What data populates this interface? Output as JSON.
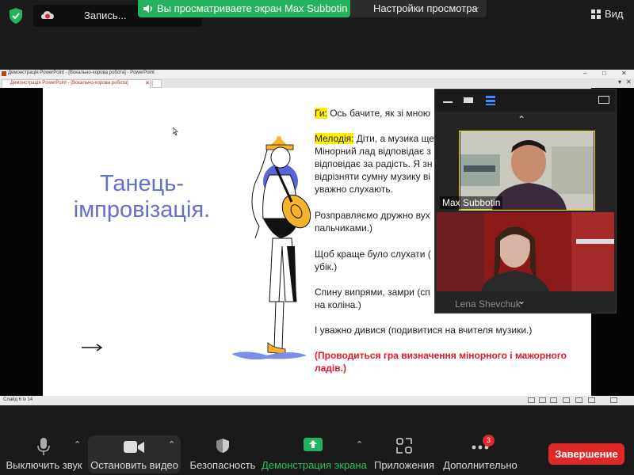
{
  "top": {
    "recording_label": "Запись...",
    "share_banner": "Вы просматриваете экран Max Subbotin",
    "view_options": "Настройки просмотра",
    "view_button": "Вид"
  },
  "ppt": {
    "window_title": "Демонстрація PowerPoint - [Вокально-хорова робота] - PowerPoint",
    "tab_title": "Демонстрація PowerPoint - [Вокально-хорова робота]",
    "status": "Слайд 6 із 14"
  },
  "slide": {
    "title_line1": "Танець-",
    "title_line2": "імпровізація.",
    "p1_label": "Ги:",
    "p1_text": " Ось бачите, як зі мною",
    "p2_label": "Мелодія:",
    "p2_text1": " Діти, а музика ще",
    "p2_text2": "Мінорний лад відповідає з",
    "p2_text3": "відповідає за радість. Я зн",
    "p2_text4": "відрізняти сумну музику ві",
    "p2_text5": "уважно слухають.",
    "p3_line1": "Розправляємо дружно вух",
    "p3_line2": "пальчиками.)",
    "p4_line1": "Щоб краще було слухати (",
    "p4_line2": "убік.)",
    "p5_line1": "Спину випрями, замри (сп",
    "p5_line2": "на коліна.)",
    "p6": "І уважно дивися (подивитися на вчителя музики.)",
    "p7_line1": "(Проводиться гра визначення мінорного і мажорного",
    "p7_line2": "ладів.)"
  },
  "panel": {
    "participant1": "Max Subbotin",
    "participant2": "Lena Shevchuk"
  },
  "toolbar": {
    "mute": "Выключить звук",
    "video": "Остановить видео",
    "security": "Безопасность",
    "share": "Демонстрация экрана",
    "apps": "Приложения",
    "more": "Дополнительно",
    "more_badge": "3",
    "end": "Завершение"
  },
  "colors": {
    "share_green": "#23b35d",
    "end_red": "#e02828",
    "highlight_yellow": "#ffee00",
    "slide_title_blue": "#6470c8"
  }
}
